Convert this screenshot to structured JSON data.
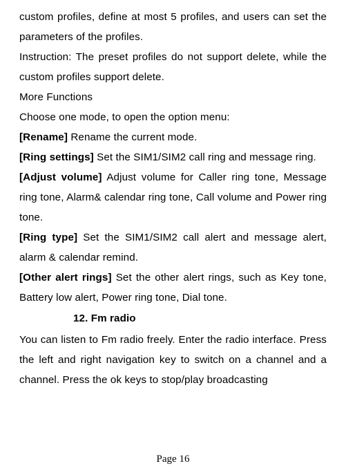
{
  "body": {
    "intro": "custom profiles, define at most 5 profiles, and users can set the parameters of the profiles.",
    "instruction": "Instruction: The preset profiles do not support delete, while the custom profiles support delete.",
    "more_functions_title": "More Functions",
    "choose_mode": "Choose one mode, to open the option menu:",
    "rename_label": "[Rename]",
    "rename_text": " Rename the current mode.",
    "ring_settings_label": "[Ring settings]",
    "ring_settings_text": " Set the SIM1/SIM2 call ring and message ring.",
    "adjust_volume_label": "[Adjust volume]",
    "adjust_volume_text": " Adjust volume for Caller ring tone, Message ring tone, Alarm& calendar ring tone, Call volume and Power ring tone.",
    "ring_type_label": "[Ring type]",
    "ring_type_text": " Set the SIM1/SIM2 call alert and message alert, alarm & calendar remind.",
    "other_alert_label": "[Other alert rings]",
    "other_alert_text": " Set the other alert rings, such as Key tone, Battery low alert, Power ring tone, Dial tone.",
    "section_heading": "12.    Fm radio",
    "fm_text": "You can listen to Fm radio freely. Enter the radio interface. Press the left and right navigation key to switch on a channel and a channel. Press the ok keys to stop/play broadcasting"
  },
  "page_number": "Page 16"
}
